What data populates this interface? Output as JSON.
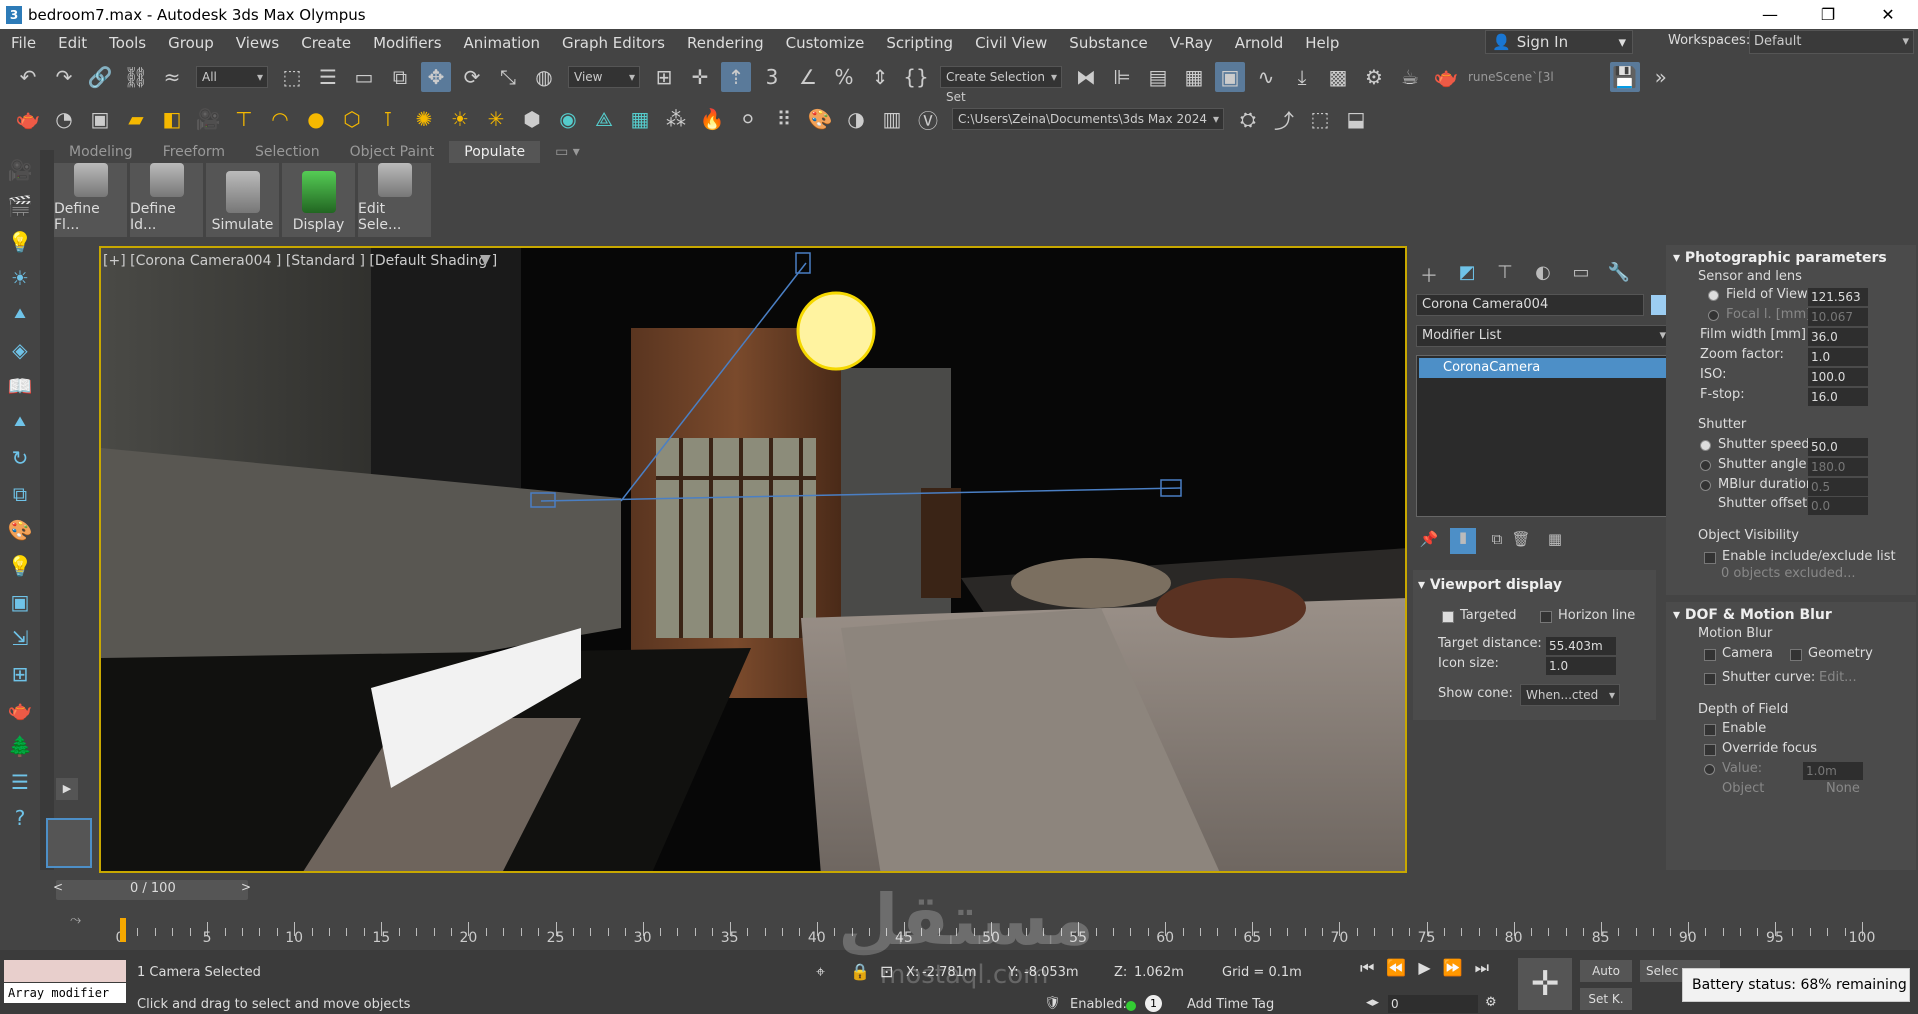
{
  "titlebar": {
    "title": "bedroom7.max - Autodesk 3ds Max Olympus",
    "logo": "3"
  },
  "menu": [
    "File",
    "Edit",
    "Tools",
    "Group",
    "Views",
    "Create",
    "Modifiers",
    "Animation",
    "Graph Editors",
    "Rendering",
    "Customize",
    "Scripting",
    "Civil View",
    "Substance",
    "V-Ray",
    "Arnold",
    "Help"
  ],
  "signin": "Sign In",
  "workspaces_label": "Workspaces:",
  "workspace_value": "Default",
  "toolbar1": {
    "filter": "All",
    "refcoord": "View",
    "selection_set": "Create Selection Set",
    "scene_label": "runeScene`[3l"
  },
  "toolbar2": {
    "path": "C:\\Users\\Zeina\\Documents\\3ds Max 2024"
  },
  "ribbon_tabs": [
    "Modeling",
    "Freeform",
    "Selection",
    "Object Paint",
    "Populate"
  ],
  "ribbon_active": "Populate",
  "ribbon_buttons": [
    "Define Fl...",
    "Define Id...",
    "Simulate",
    "Display",
    "Edit Sele..."
  ],
  "viewport": {
    "label": "[+] [Corona Camera004 ] [Standard ] [Default Shading ]"
  },
  "cmd": {
    "object_name": "Corona Camera004",
    "object_color": "#9ccdf2",
    "modifier_list": "Modifier List",
    "stack_item": "CoronaCamera",
    "viewport_display": {
      "title": "Viewport display",
      "targeted": "Targeted",
      "horizon": "Horizon line",
      "target_distance_label": "Target distance:",
      "target_distance": "55.403m",
      "icon_size_label": "Icon size:",
      "icon_size": "1.0",
      "show_cone_label": "Show cone:",
      "show_cone": "When...cted"
    },
    "photographic": {
      "title": "Photographic parameters",
      "sensor": "Sensor and lens",
      "fov_label": "Field of View",
      "fov": "121.563",
      "focal_label": "Focal l. [mm]",
      "focal": "10.067",
      "film_label": "Film width [mm]",
      "film": "36.0",
      "zoom_label": "Zoom factor:",
      "zoom": "1.0",
      "iso_label": "ISO:",
      "iso": "100.0",
      "fstop_label": "F-stop:",
      "fstop": "16.0",
      "shutter": "Shutter",
      "speed_label": "Shutter speed:",
      "speed": "50.0",
      "angle_label": "Shutter angle:",
      "angle": "180.0",
      "mblur_label": "MBlur duration:",
      "mblur": "0.5",
      "offset_label": "Shutter offset:",
      "offset": "0.0",
      "visibility": "Object Visibility",
      "include_label": "Enable include/exclude list",
      "excluded": "0 objects excluded..."
    },
    "dof": {
      "title": "DOF & Motion Blur",
      "motion": "Motion Blur",
      "camera": "Camera",
      "geometry": "Geometry",
      "curve_label": "Shutter curve:",
      "curve_btn": "Edit...",
      "depth": "Depth of Field",
      "enable": "Enable",
      "override": "Override focus",
      "value_label": "Value:",
      "value": "1.0m",
      "object_label": "Object",
      "object_btn": "None"
    }
  },
  "timeline": {
    "frame": "0 / 100",
    "ticks": [
      "0",
      "5",
      "10",
      "15",
      "20",
      "25",
      "30",
      "35",
      "40",
      "45",
      "50",
      "55",
      "60",
      "65",
      "70",
      "75",
      "80",
      "85",
      "90",
      "95",
      "100"
    ]
  },
  "status": {
    "array": "Array modifier",
    "selected": "1 Camera Selected",
    "hint": "Click and drag to select and move objects",
    "x_label": "X:",
    "x": "-2.781m",
    "y_label": "Y:",
    "y": "-8.053m",
    "z_label": "Z:",
    "z": "1.062m",
    "grid": "Grid = 0.1m",
    "enabled": "Enabled:",
    "add_time_tag": "Add Time Tag",
    "auto": "Auto",
    "setk": "Set K.",
    "select": "Selec",
    "frame_value": "0",
    "battery": "Battery status: 68% remaining"
  },
  "watermark": {
    "arabic": "مستقل",
    "latin": "mostaql.com"
  }
}
